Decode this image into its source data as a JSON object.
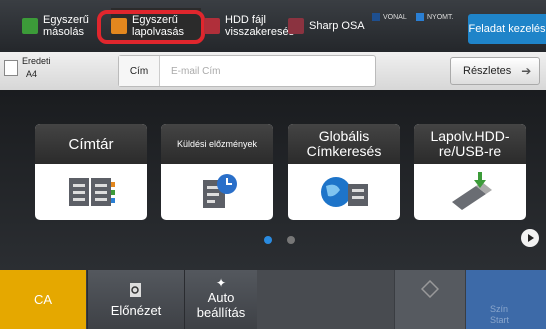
{
  "top_tabs": [
    {
      "label_line1": "Egyszerű",
      "label_line2": "másolás",
      "icon": "copy-icon",
      "color": "#3c9b39"
    },
    {
      "label_line1": "Egyszerű",
      "label_line2": "lapolvasás",
      "icon": "scan-icon",
      "color": "#e3871e"
    },
    {
      "label_line1": "HDD fájl",
      "label_line2": "visszakeresés",
      "icon": "hdd-icon",
      "color": "#b02f3a"
    },
    {
      "label": "Sharp OSA",
      "icon": "osa-icon",
      "color": "#8b3340"
    }
  ],
  "status": {
    "line": "VONAL",
    "print": "NYOMT."
  },
  "task_button": "Feladat kezelés",
  "info": {
    "original_line1": "Eredeti",
    "original_line2": "A4",
    "cim_label": "Cím",
    "cim_placeholder": "E-mail Cím",
    "details": "Részletes"
  },
  "tiles": [
    {
      "label": "Címtár",
      "icon": "address-book-icon"
    },
    {
      "label": "Küldési előzmények",
      "icon": "send-history-icon"
    },
    {
      "label_line1": "Globális",
      "label_line2": "Címkeresés",
      "icon": "global-search-icon"
    },
    {
      "label_line1": "Lapolv.HDD-",
      "label_line2": "re/USB-re",
      "icon": "usb-icon"
    }
  ],
  "pager": {
    "active": 1,
    "total": 2
  },
  "bottom": {
    "ca": "CA",
    "preview": "Előnézet",
    "auto_line1": "Auto",
    "auto_line2": "beállítás",
    "color_line1": "Szín",
    "color_line2": "Start"
  },
  "colors": {
    "highlight": "#e0262d",
    "accent": "#1f84c9",
    "ca": "#e5a800"
  }
}
